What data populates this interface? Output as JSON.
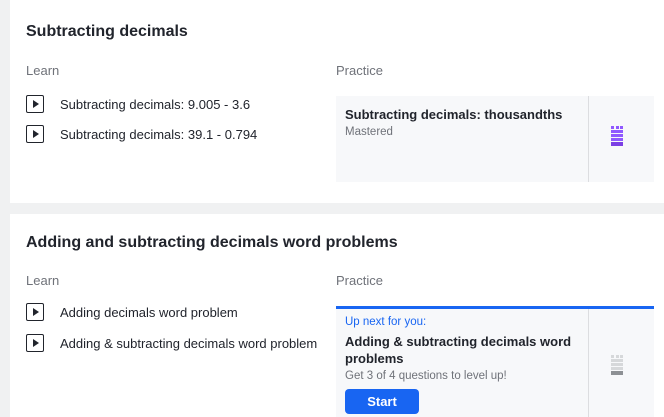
{
  "units": [
    {
      "title": "Subtracting decimals",
      "learn_label": "Learn",
      "practice_label": "Practice",
      "videos": [
        {
          "label": "Subtracting decimals: 9.005 - 3.6"
        },
        {
          "label": "Subtracting decimals: 39.1 - 0.794"
        }
      ],
      "practice": {
        "title": "Subtracting decimals: thousandths",
        "status": "Mastered",
        "mastery_icon": "mastered-tower-icon",
        "mastery_color": "#9059ff"
      }
    },
    {
      "title": "Adding and subtracting decimals word problems",
      "learn_label": "Learn",
      "practice_label": "Practice",
      "videos": [
        {
          "label": "Adding decimals word problem"
        },
        {
          "label": "Adding & subtracting decimals word problem"
        }
      ],
      "practice": {
        "up_next": "Up next for you:",
        "title_line1": "Adding & subtracting decimals word",
        "title_line2": "problems",
        "subtitle": "Get 3 of 4 questions to level up!",
        "button": "Start",
        "mastery_icon": "not-started-tower-icon",
        "mastery_color": "#d6d8da",
        "accent_color": "#1865f2"
      }
    }
  ],
  "icons": {
    "video": "play-icon"
  }
}
